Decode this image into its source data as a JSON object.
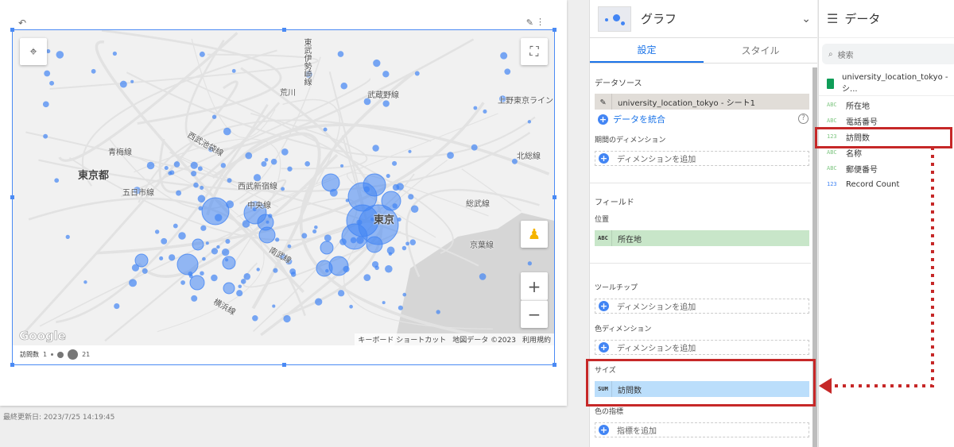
{
  "report": {
    "last_updated": "最終更新日: 2023/7/25 14:19:45"
  },
  "map": {
    "labels": [
      "東京都",
      "五日市線",
      "青梅線",
      "西武池袋線",
      "西武新宿線",
      "中央線",
      "南武線",
      "横浜線",
      "武蔵野線",
      "荒川",
      "上野東京ライン",
      "北総線",
      "総武線",
      "京葉線",
      "東京",
      "東武伊勢崎線"
    ],
    "attribution": [
      "キーボード ショートカット",
      "地図データ ©2023",
      "利用規約"
    ],
    "google_logo": "Google",
    "bubble_color": "#4285f4",
    "zoom_in": "+",
    "zoom_out": "−"
  },
  "legend": {
    "title": "訪問数",
    "min": "1",
    "max": "21"
  },
  "panel": {
    "title": "グラフ",
    "tabs": [
      {
        "label": "設定"
      },
      {
        "label": "スタイル"
      }
    ],
    "datasource_label": "データソース",
    "datasource": "university_location_tokyo - シート1",
    "blend": "データを統合",
    "period_dim": "期間のディメンション",
    "add_dim": "ディメンションを追加",
    "fields_label": "フィールド",
    "location_label": "位置",
    "location": {
      "type": "ABC",
      "name": "所在地"
    },
    "tooltip_label": "ツールチップ",
    "color_dim_label": "色ディメンション",
    "size_label": "サイズ",
    "size": {
      "type": "SUM",
      "name": "訪問数"
    },
    "color_metric_label": "色の指標",
    "add_metric": "指標を追加"
  },
  "data_panel": {
    "title": "データ",
    "search_placeholder": "検索",
    "source": "university_location_tokyo - シ...",
    "fields": [
      {
        "type": "ABC",
        "name": "所在地"
      },
      {
        "type": "ABC",
        "name": "電話番号"
      },
      {
        "type": "123",
        "name": "訪問数"
      },
      {
        "type": "ABC",
        "name": "名称"
      },
      {
        "type": "ABC",
        "name": "郵便番号"
      },
      {
        "type": "123",
        "name": "Record Count"
      }
    ]
  },
  "annotation_color": "#c62828"
}
